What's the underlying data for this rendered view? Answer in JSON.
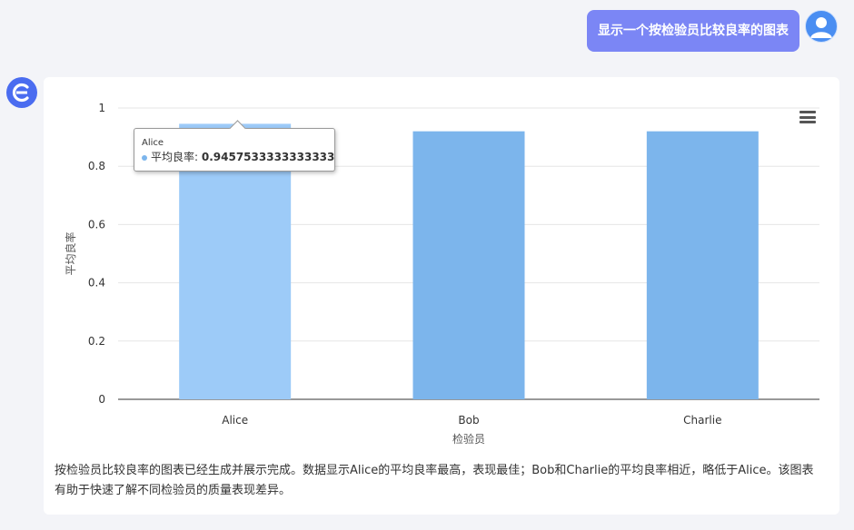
{
  "user_message": "显示一个按检验员比较良率的图表",
  "chart_data": {
    "type": "bar",
    "categories": [
      "Alice",
      "Bob",
      "Charlie"
    ],
    "values": [
      0.9457533333333333,
      0.92,
      0.92
    ],
    "xlabel": "检验员",
    "ylabel": "平均良率",
    "ylim": [
      0,
      1
    ],
    "yticks": [
      "0",
      "0.2",
      "0.4",
      "0.6",
      "0.8",
      "1"
    ],
    "colors": {
      "bar": "#7cb5ec",
      "bar_hover": "#9dcbf8"
    },
    "grid": true
  },
  "tooltip": {
    "category": "Alice",
    "series_label": "平均良率:",
    "value": "0.9457533333333333"
  },
  "summary": "按检验员比较良率的图表已经生成并展示完成。数据显示Alice的平均良率最高，表现最佳；Bob和Charlie的平均良率相近，略低于Alice。该图表有助于快速了解不同检验员的质量表现差异。"
}
